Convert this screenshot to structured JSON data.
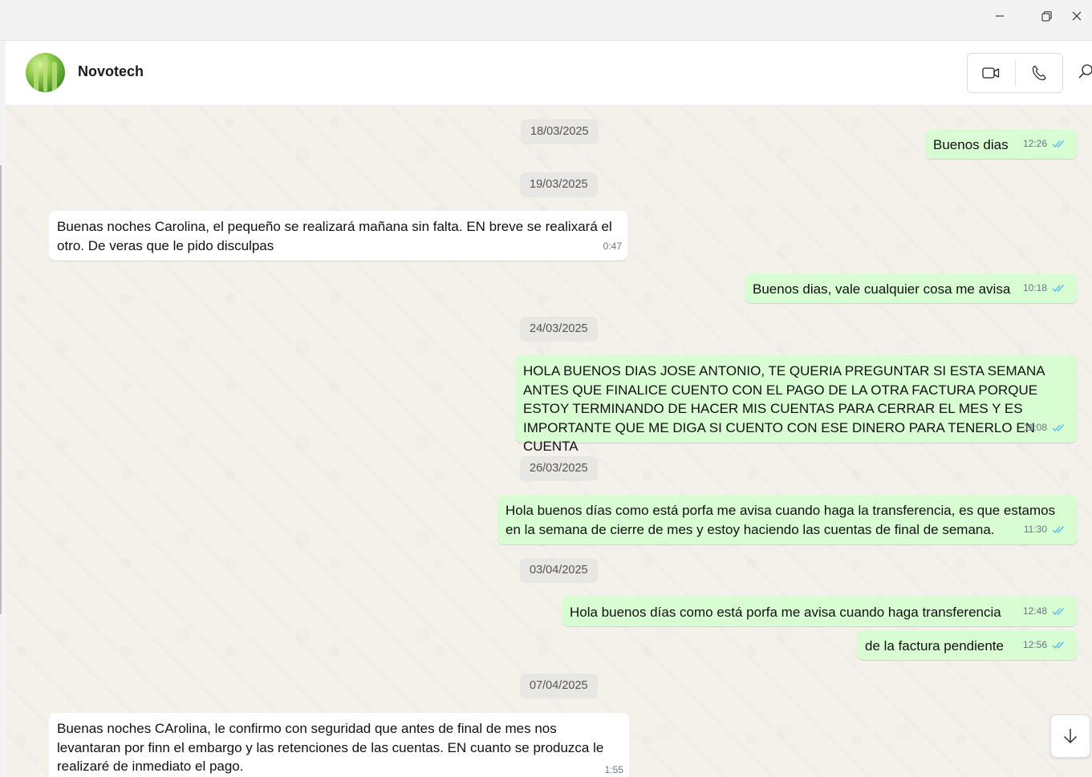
{
  "window": {
    "controls": [
      "minimize-icon",
      "restore-icon",
      "close-icon"
    ]
  },
  "header": {
    "contact_name": "Novotech",
    "icons": [
      "video-call-icon",
      "voice-call-icon",
      "search-icon"
    ]
  },
  "messages": [
    {
      "kind": "date",
      "text": "18/03/2025"
    },
    {
      "kind": "out",
      "text": "Buenos dias",
      "time": "12:26",
      "status": "read"
    },
    {
      "kind": "date",
      "text": "19/03/2025"
    },
    {
      "kind": "in",
      "text": "Buenas noches Carolina, el pequeño se realizará mañana sin falta. EN breve se realixará el otro. De veras que le pido disculpas",
      "time": "0:47"
    },
    {
      "kind": "out",
      "text": "Buenos dias, vale cualquier cosa me avisa",
      "time": "10:18",
      "status": "read"
    },
    {
      "kind": "date",
      "text": "24/03/2025"
    },
    {
      "kind": "out",
      "text": "HOLA BUENOS DIAS JOSE ANTONIO, TE QUERIA PREGUNTAR SI ESTA SEMANA ANTES QUE FINALICE CUENTO CON EL PAGO DE LA OTRA FACTURA PORQUE ESTOY TERMINANDO DE HACER MIS CUENTAS PARA CERRAR EL MES Y ES IMPORTANTE QUE ME DIGA SI CUENTO CON ESE DINERO PARA TENERLO EN CUENTA",
      "time": "11:08",
      "status": "read"
    },
    {
      "kind": "date",
      "text": "26/03/2025"
    },
    {
      "kind": "out",
      "text": "Hola buenos días como está porfa me avisa cuando haga la transferencia, es que estamos en la semana de cierre de mes y estoy haciendo las cuentas de final de semana.",
      "time": "11:30",
      "status": "read"
    },
    {
      "kind": "date",
      "text": "03/04/2025"
    },
    {
      "kind": "out",
      "text": "Hola buenos días como está porfa me avisa cuando haga transferencia",
      "time": "12:48",
      "status": "read"
    },
    {
      "kind": "out",
      "text": "de la factura pendiente",
      "time": "12:56",
      "status": "read"
    },
    {
      "kind": "date",
      "text": "07/04/2025"
    },
    {
      "kind": "in",
      "text": "Buenas noches CArolina, le confirmo con seguridad que antes de final de mes nos levantaran por finn el embargo y las retenciones de las cuentas. EN cuanto se produzca le realizaré de inmediato el pago.",
      "time": "1:55"
    }
  ],
  "scroll_down_icon": "arrow-down-icon",
  "colors": {
    "outgoing_bubble": "#d9fdd3",
    "incoming_bubble": "#ffffff",
    "read_tick": "#53bdeb",
    "chat_background": "#efeae2"
  }
}
